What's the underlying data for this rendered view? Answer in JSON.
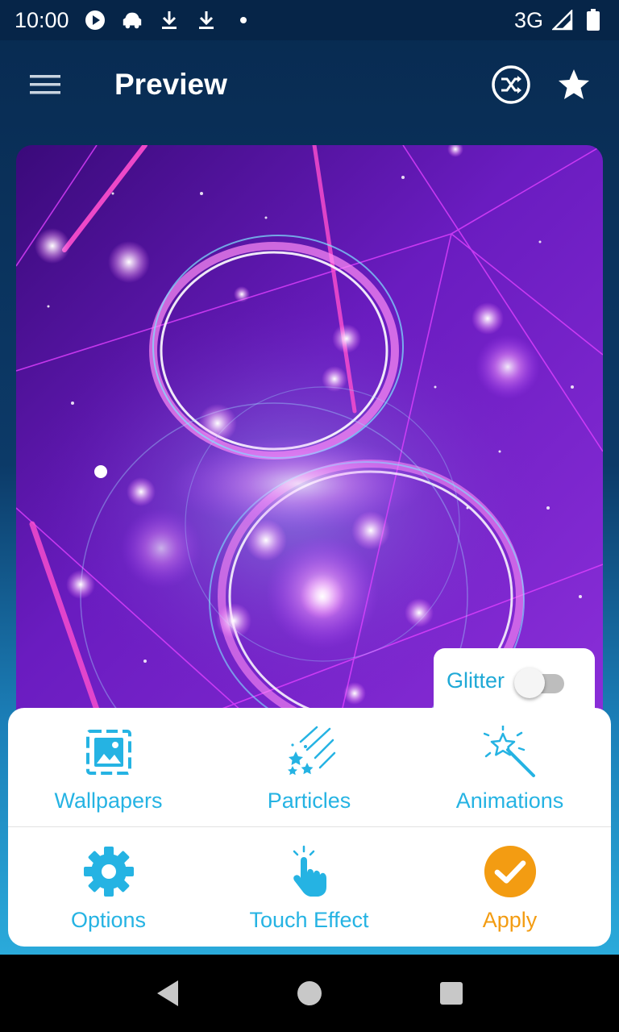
{
  "status_bar": {
    "time": "10:00",
    "network": "3G",
    "icons": [
      "play-icon",
      "car-icon",
      "download-icon",
      "download-icon",
      "dot-icon",
      "signal-icon",
      "battery-icon"
    ]
  },
  "app_bar": {
    "title": "Preview",
    "icons": [
      "menu-icon",
      "shuffle-icon",
      "star-icon"
    ]
  },
  "preview": {
    "description_icons": [
      "wallpaper-preview"
    ]
  },
  "glitter": {
    "label": "Glitter",
    "enabled": false
  },
  "panel": {
    "row1": [
      {
        "label": "Wallpapers",
        "icon": "image-icon"
      },
      {
        "label": "Particles",
        "icon": "particles-icon"
      },
      {
        "label": "Animations",
        "icon": "magic-wand-icon"
      }
    ],
    "row2": [
      {
        "label": "Options",
        "icon": "gear-icon"
      },
      {
        "label": "Touch Effect",
        "icon": "touch-icon"
      },
      {
        "label": "Apply",
        "icon": "check-circle-icon"
      }
    ]
  },
  "colors": {
    "accent": "#25b3e3",
    "apply": "#f39c12",
    "header": "#062548"
  },
  "nav_bar": {
    "icons": [
      "back-icon",
      "home-icon",
      "recents-icon"
    ]
  }
}
